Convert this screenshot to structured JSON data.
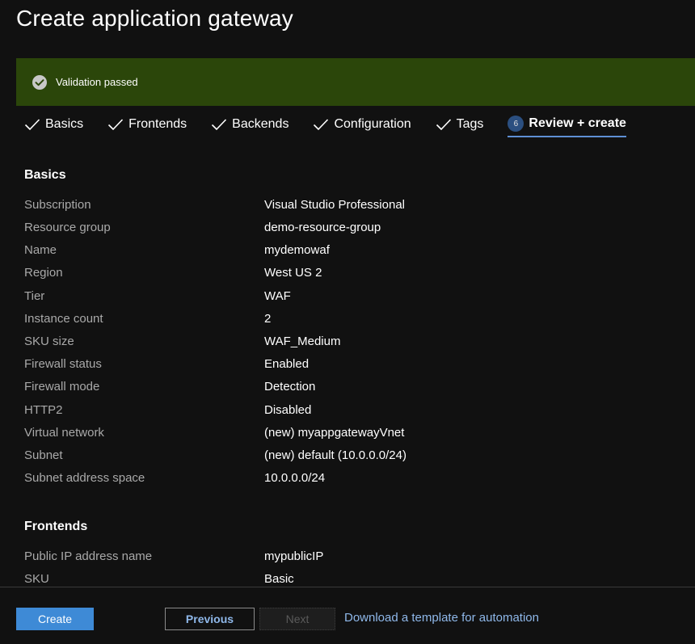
{
  "header": {
    "title": "Create application gateway"
  },
  "banner": {
    "text": "Validation passed",
    "icon": "checkmark-circle-icon",
    "color": "#2b460a"
  },
  "tabs": [
    {
      "label": "Basics",
      "state": "completed"
    },
    {
      "label": "Frontends",
      "state": "completed"
    },
    {
      "label": "Backends",
      "state": "completed"
    },
    {
      "label": "Configuration",
      "state": "completed"
    },
    {
      "label": "Tags",
      "state": "completed"
    },
    {
      "label": "Review + create",
      "state": "active",
      "step": "6"
    }
  ],
  "sections": {
    "basics": {
      "title": "Basics",
      "rows": [
        {
          "label": "Subscription",
          "value": "Visual Studio Professional"
        },
        {
          "label": "Resource group",
          "value": "demo-resource-group"
        },
        {
          "label": "Name",
          "value": "mydemowaf"
        },
        {
          "label": "Region",
          "value": "West US 2"
        },
        {
          "label": "Tier",
          "value": "WAF"
        },
        {
          "label": "Instance count",
          "value": "2"
        },
        {
          "label": "SKU size",
          "value": "WAF_Medium"
        },
        {
          "label": "Firewall status",
          "value": "Enabled"
        },
        {
          "label": "Firewall mode",
          "value": "Detection"
        },
        {
          "label": "HTTP2",
          "value": "Disabled"
        },
        {
          "label": "Virtual network",
          "value": "(new) myappgatewayVnet"
        },
        {
          "label": "Subnet",
          "value": "(new) default (10.0.0.0/24)"
        },
        {
          "label": "Subnet address space",
          "value": "10.0.0.0/24"
        }
      ]
    },
    "frontends": {
      "title": "Frontends",
      "rows": [
        {
          "label": "Public IP address name",
          "value": "mypublicIP"
        },
        {
          "label": "SKU",
          "value": "Basic"
        }
      ]
    }
  },
  "footer": {
    "create_label": "Create",
    "previous_label": "Previous",
    "next_label": "Next",
    "download_link": "Download a template for automation"
  },
  "colors": {
    "background": "#111111",
    "accent": "#3e8ad6",
    "link": "#8fb8ea",
    "active_tab_underline": "#5e8fd4"
  }
}
